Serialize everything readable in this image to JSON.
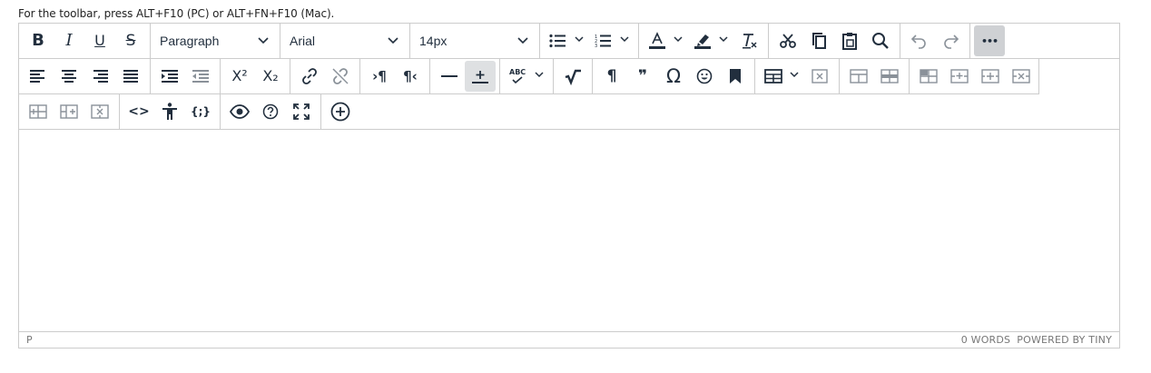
{
  "hint_text": "For the toolbar, press ALT+F10 (PC) or ALT+FN+F10 (Mac).",
  "toolbar": {
    "bold_label": "B",
    "italic_label": "I",
    "underline_label": "U",
    "strike_label": "S",
    "block_format": "Paragraph",
    "font_family": "Arial",
    "font_size": "14px",
    "superscript_label": "X²",
    "subscript_label": "X₂",
    "omega_label": "Ω",
    "quote_label": "❞",
    "pilcrow_label": "¶",
    "ltr_label": "›¶",
    "rtl_label": "¶‹",
    "spellcheck_label": "ABC",
    "source_label": "<>",
    "template_label": "{;}",
    "more_label": "•••"
  },
  "statusbar": {
    "path": "P",
    "word_count": "0 WORDS",
    "powered_by": "POWERED BY TINY"
  },
  "colors": {
    "border": "#cccccc",
    "icon": "#222f3e",
    "active_bg": "#dee0e2",
    "status_text": "#777777"
  }
}
